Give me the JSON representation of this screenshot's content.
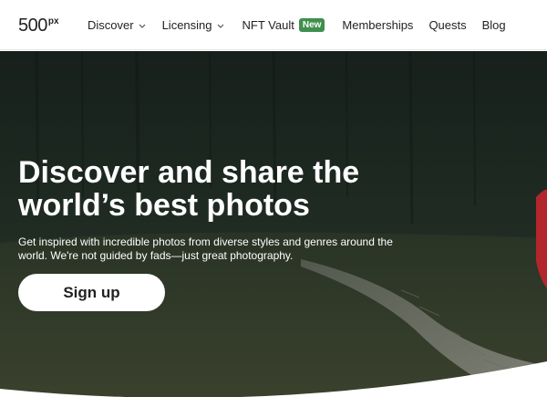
{
  "logo": {
    "text": "500",
    "superscript": "px"
  },
  "nav": {
    "discover": "Discover",
    "licensing": "Licensing",
    "nft_vault": "NFT Vault",
    "nft_badge": "New",
    "memberships": "Memberships",
    "quests": "Quests",
    "blog": "Blog"
  },
  "hero": {
    "headline_line1": "Discover and share the",
    "headline_line2": "world’s best photos",
    "subtext_line1": "Get inspired with incredible photos from diverse styles and genres around the",
    "subtext_line2": "world. We're not guided by fads—just great photography.",
    "cta_label": "Sign up"
  },
  "colors": {
    "badge": "#3f8f4e",
    "hero_overlay": "#1d2a22",
    "text_dark": "#222222"
  }
}
